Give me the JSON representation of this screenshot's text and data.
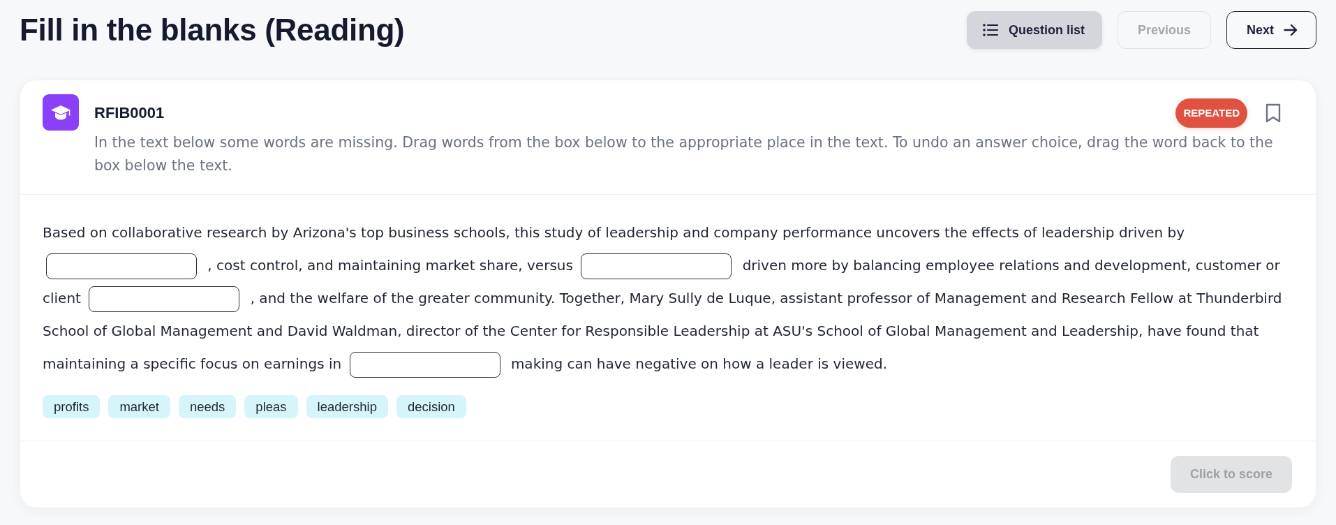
{
  "page": {
    "title": "Fill in the blanks (Reading)"
  },
  "toolbar": {
    "buttons": [
      {
        "kind": "list",
        "label": "Question list",
        "disabled": false
      },
      {
        "kind": "plain",
        "label": "Previous",
        "disabled": true
      },
      {
        "kind": "arrow",
        "label": "Next",
        "disabled": false
      }
    ]
  },
  "question": {
    "code": "RFIB0001",
    "badge": "REPEATED",
    "bookmarked": false,
    "instructions": "In the text below some words are missing. Drag words from the box below to the appropriate place in the text. To undo an answer choice, drag the word back to the box below the text.",
    "passage": [
      {
        "kind": "text",
        "text": "Based on collaborative research by Arizona's top business schools, this study of leadership and company performance uncovers the effects of leadership driven by"
      },
      {
        "kind": "blank"
      },
      {
        "kind": "text",
        "text": ", cost control, and maintaining market share, versus"
      },
      {
        "kind": "blank"
      },
      {
        "kind": "text",
        "text": "driven more by balancing employee relations and development, customer or client"
      },
      {
        "kind": "blank"
      },
      {
        "kind": "text",
        "text": ", and the welfare of the greater community. Together, Mary Sully de Luque, assistant professor of Management and Research Fellow at Thunderbird School of Global Management and David Waldman, director of the Center for Responsible Leadership at ASU's School of Global Management and Leadership, have found that maintaining a specific focus on earnings in"
      },
      {
        "kind": "blank"
      },
      {
        "kind": "text",
        "text": "making can have negative on how a leader is viewed."
      }
    ],
    "words": [
      "profits",
      "market",
      "needs",
      "pleas",
      "leadership",
      "decision"
    ],
    "score_button": {
      "label": "Click to score",
      "disabled": true
    }
  }
}
